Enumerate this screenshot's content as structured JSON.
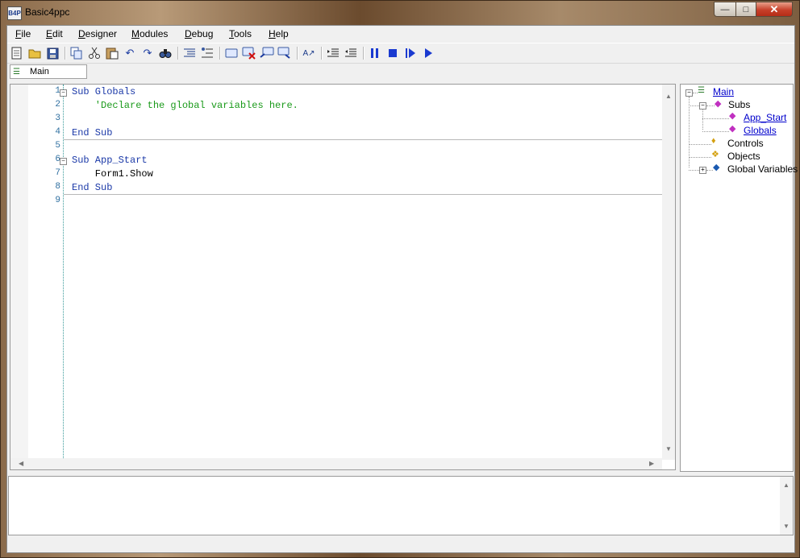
{
  "window": {
    "title": "Basic4ppc",
    "app_icon_text": "B4P"
  },
  "menu": [
    {
      "label": "File"
    },
    {
      "label": "Edit"
    },
    {
      "label": "Designer"
    },
    {
      "label": "Modules"
    },
    {
      "label": "Debug"
    },
    {
      "label": "Tools"
    },
    {
      "label": "Help"
    }
  ],
  "toolbar": [
    "new-file-icon",
    "open-folder-icon",
    "save-icon",
    "copy-icon",
    "cut-icon",
    "paste-icon",
    "undo-icon",
    "redo-icon",
    "find-icon",
    "indent-list-icon",
    "outline-icon",
    "form-icon",
    "delete-form-icon",
    "comment-icon",
    "uncomment-icon",
    "font-size-icon",
    "indent-icon",
    "outdent-icon",
    "pause-icon",
    "stop-icon",
    "step-icon",
    "run-icon"
  ],
  "module_tab": {
    "label": "Main"
  },
  "editor": {
    "lines": [
      {
        "num": "1",
        "text": "Sub Globals"
      },
      {
        "num": "2",
        "text": "    'Declare the global variables here."
      },
      {
        "num": "3",
        "text": ""
      },
      {
        "num": "4",
        "text": "End Sub"
      },
      {
        "num": "5",
        "text": ""
      },
      {
        "num": "6",
        "text": "Sub App_Start"
      },
      {
        "num": "7",
        "text": "    Form1.Show"
      },
      {
        "num": "8",
        "text": "End Sub"
      },
      {
        "num": "9",
        "text": ""
      }
    ],
    "colors": {
      "keyword": "#1c3aa8",
      "comment": "#1a9a1a",
      "line_number": "#2f6fa0"
    }
  },
  "tree": {
    "root": "Main",
    "subs_label": "Subs",
    "subs": [
      "App_Start",
      "Globals"
    ],
    "controls": "Controls",
    "objects": "Objects",
    "globals": "Global Variables"
  }
}
